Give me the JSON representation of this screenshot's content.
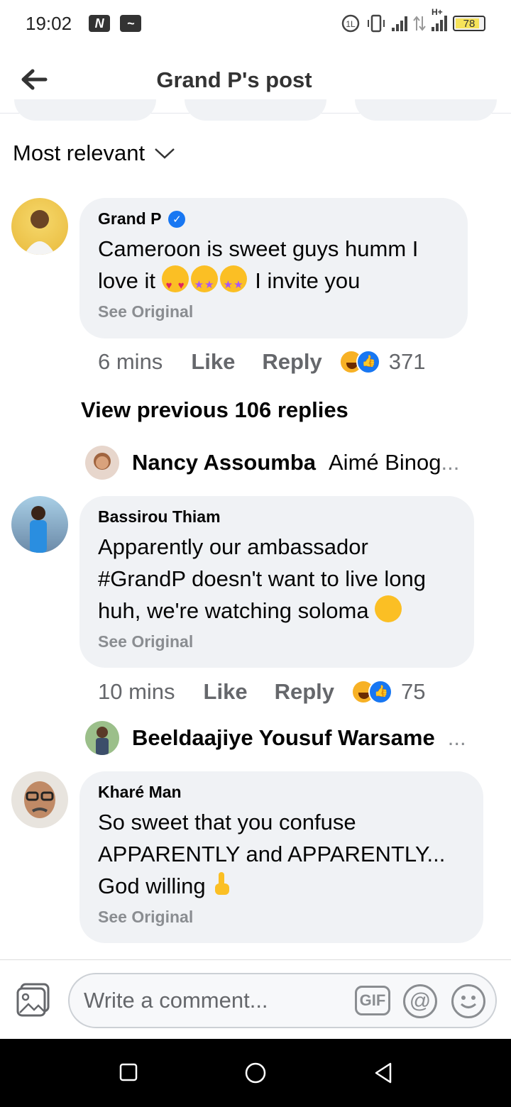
{
  "status_bar": {
    "time": "19:02",
    "battery": "78",
    "network": "H+"
  },
  "header": {
    "title": "Grand P's post"
  },
  "sort": {
    "label": "Most relevant"
  },
  "comments": [
    {
      "author": "Grand P",
      "verified": true,
      "text_before_emoji": "Cameroon is sweet guys humm I love it ",
      "text_after_emoji": " I invite you",
      "see_original": "See Original",
      "time": "6 mins",
      "like": "Like",
      "reply": "Reply",
      "reaction_count": "371"
    },
    {
      "author": "Bassirou Thiam",
      "text": "Apparently our ambassador #GrandP doesn't want to live long huh, we're watching soloma ",
      "see_original": "See Original",
      "time": "10 mins",
      "like": "Like",
      "reply": "Reply",
      "reaction_count": "75"
    },
    {
      "author": "Kharé Man",
      "text": "So sweet that you confuse APPARENTLY and APPARENTLY... God willing ",
      "see_original": "See Original"
    }
  ],
  "view_previous": "View previous 106 replies",
  "reply_previews": [
    {
      "name": "Nancy Assoumba",
      "text": "Aimé Binog",
      "ellipsis": "..."
    },
    {
      "name": "Beeldaajiye Yousuf Warsame",
      "text": "",
      "ellipsis": "..."
    }
  ],
  "composer": {
    "placeholder": "Write a comment...",
    "gif_label": "GIF",
    "mention_label": "@"
  },
  "colors": {
    "bubble": "#f0f2f5",
    "meta": "#65676b",
    "accent": "#1877f2"
  }
}
